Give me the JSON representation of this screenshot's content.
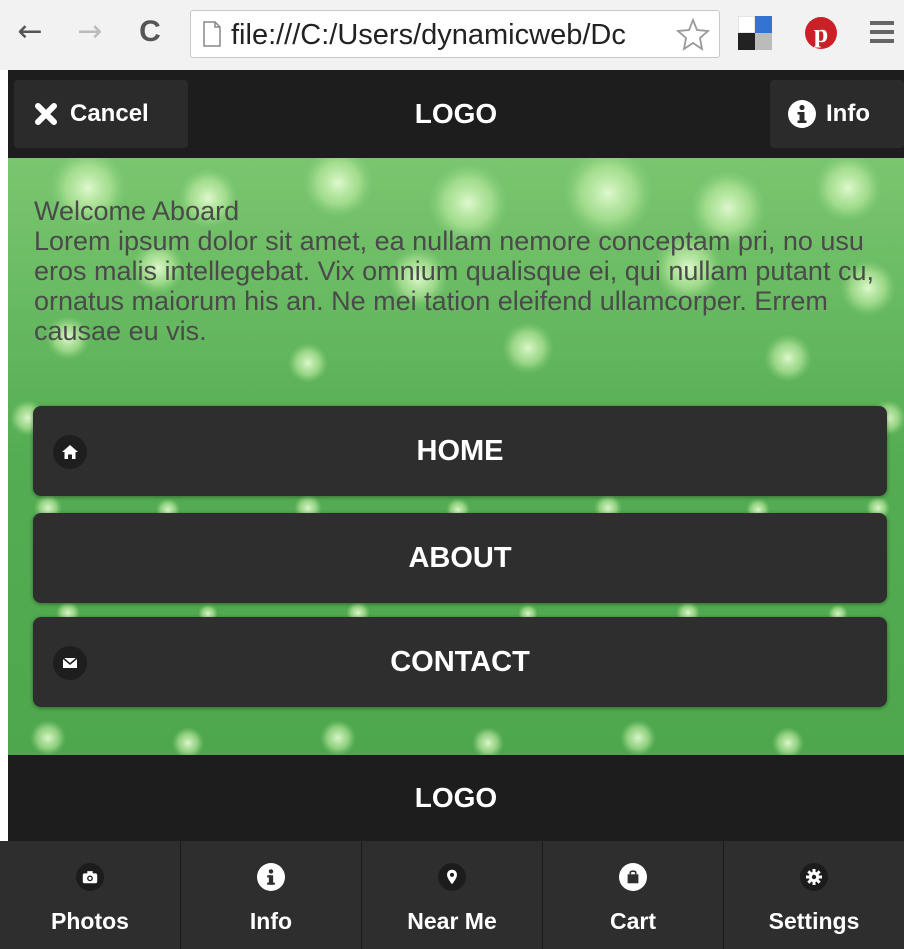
{
  "browser": {
    "url": "file:///C:/Users/dynamicweb/Dc",
    "back_glyph": "←",
    "forward_glyph": "→",
    "reload_glyph": "C"
  },
  "header": {
    "cancel_label": "Cancel",
    "logo": "LOGO",
    "info_label": "Info"
  },
  "content": {
    "heading": "Welcome Aboard",
    "body": "Lorem ipsum dolor sit amet, ea nullam nemore conceptam pri, no usu eros malis intellegebat. Vix omnium qualisque ei, qui nullam putant cu, ornatus maiorum his an. Ne mei tation eleifend ullamcorper. Errem causae eu vis."
  },
  "nav": {
    "items": [
      {
        "label": "HOME",
        "icon": "home-icon"
      },
      {
        "label": "ABOUT",
        "icon": ""
      },
      {
        "label": "CONTACT",
        "icon": "mail-icon"
      }
    ]
  },
  "footer": {
    "logo": "LOGO",
    "tabs": [
      {
        "label": "Photos",
        "icon": "camera-icon"
      },
      {
        "label": "Info",
        "icon": "info-icon"
      },
      {
        "label": "Near Me",
        "icon": "location-pin-icon"
      },
      {
        "label": "Cart",
        "icon": "shopping-bag-icon"
      },
      {
        "label": "Settings",
        "icon": "gear-icon"
      }
    ]
  },
  "colors": {
    "bar_dark": "#1d1d1d",
    "button_dark": "#2e2e2e",
    "background_green": "#5fb35b",
    "pinterest_red": "#cb2027"
  }
}
